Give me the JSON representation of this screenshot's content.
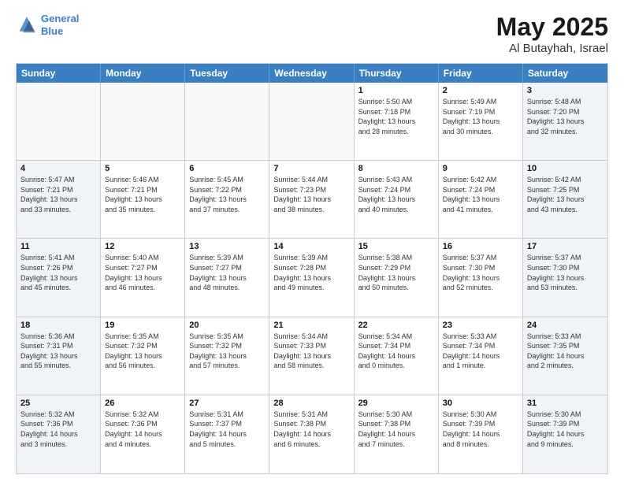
{
  "header": {
    "logo_line1": "General",
    "logo_line2": "Blue",
    "month": "May 2025",
    "location": "Al Butayhah, Israel"
  },
  "weekdays": [
    "Sunday",
    "Monday",
    "Tuesday",
    "Wednesday",
    "Thursday",
    "Friday",
    "Saturday"
  ],
  "rows": [
    [
      {
        "day": "",
        "info": ""
      },
      {
        "day": "",
        "info": ""
      },
      {
        "day": "",
        "info": ""
      },
      {
        "day": "",
        "info": ""
      },
      {
        "day": "1",
        "info": "Sunrise: 5:50 AM\nSunset: 7:18 PM\nDaylight: 13 hours\nand 28 minutes."
      },
      {
        "day": "2",
        "info": "Sunrise: 5:49 AM\nSunset: 7:19 PM\nDaylight: 13 hours\nand 30 minutes."
      },
      {
        "day": "3",
        "info": "Sunrise: 5:48 AM\nSunset: 7:20 PM\nDaylight: 13 hours\nand 32 minutes."
      }
    ],
    [
      {
        "day": "4",
        "info": "Sunrise: 5:47 AM\nSunset: 7:21 PM\nDaylight: 13 hours\nand 33 minutes."
      },
      {
        "day": "5",
        "info": "Sunrise: 5:46 AM\nSunset: 7:21 PM\nDaylight: 13 hours\nand 35 minutes."
      },
      {
        "day": "6",
        "info": "Sunrise: 5:45 AM\nSunset: 7:22 PM\nDaylight: 13 hours\nand 37 minutes."
      },
      {
        "day": "7",
        "info": "Sunrise: 5:44 AM\nSunset: 7:23 PM\nDaylight: 13 hours\nand 38 minutes."
      },
      {
        "day": "8",
        "info": "Sunrise: 5:43 AM\nSunset: 7:24 PM\nDaylight: 13 hours\nand 40 minutes."
      },
      {
        "day": "9",
        "info": "Sunrise: 5:42 AM\nSunset: 7:24 PM\nDaylight: 13 hours\nand 41 minutes."
      },
      {
        "day": "10",
        "info": "Sunrise: 5:42 AM\nSunset: 7:25 PM\nDaylight: 13 hours\nand 43 minutes."
      }
    ],
    [
      {
        "day": "11",
        "info": "Sunrise: 5:41 AM\nSunset: 7:26 PM\nDaylight: 13 hours\nand 45 minutes."
      },
      {
        "day": "12",
        "info": "Sunrise: 5:40 AM\nSunset: 7:27 PM\nDaylight: 13 hours\nand 46 minutes."
      },
      {
        "day": "13",
        "info": "Sunrise: 5:39 AM\nSunset: 7:27 PM\nDaylight: 13 hours\nand 48 minutes."
      },
      {
        "day": "14",
        "info": "Sunrise: 5:39 AM\nSunset: 7:28 PM\nDaylight: 13 hours\nand 49 minutes."
      },
      {
        "day": "15",
        "info": "Sunrise: 5:38 AM\nSunset: 7:29 PM\nDaylight: 13 hours\nand 50 minutes."
      },
      {
        "day": "16",
        "info": "Sunrise: 5:37 AM\nSunset: 7:30 PM\nDaylight: 13 hours\nand 52 minutes."
      },
      {
        "day": "17",
        "info": "Sunrise: 5:37 AM\nSunset: 7:30 PM\nDaylight: 13 hours\nand 53 minutes."
      }
    ],
    [
      {
        "day": "18",
        "info": "Sunrise: 5:36 AM\nSunset: 7:31 PM\nDaylight: 13 hours\nand 55 minutes."
      },
      {
        "day": "19",
        "info": "Sunrise: 5:35 AM\nSunset: 7:32 PM\nDaylight: 13 hours\nand 56 minutes."
      },
      {
        "day": "20",
        "info": "Sunrise: 5:35 AM\nSunset: 7:32 PM\nDaylight: 13 hours\nand 57 minutes."
      },
      {
        "day": "21",
        "info": "Sunrise: 5:34 AM\nSunset: 7:33 PM\nDaylight: 13 hours\nand 58 minutes."
      },
      {
        "day": "22",
        "info": "Sunrise: 5:34 AM\nSunset: 7:34 PM\nDaylight: 14 hours\nand 0 minutes."
      },
      {
        "day": "23",
        "info": "Sunrise: 5:33 AM\nSunset: 7:34 PM\nDaylight: 14 hours\nand 1 minute."
      },
      {
        "day": "24",
        "info": "Sunrise: 5:33 AM\nSunset: 7:35 PM\nDaylight: 14 hours\nand 2 minutes."
      }
    ],
    [
      {
        "day": "25",
        "info": "Sunrise: 5:32 AM\nSunset: 7:36 PM\nDaylight: 14 hours\nand 3 minutes."
      },
      {
        "day": "26",
        "info": "Sunrise: 5:32 AM\nSunset: 7:36 PM\nDaylight: 14 hours\nand 4 minutes."
      },
      {
        "day": "27",
        "info": "Sunrise: 5:31 AM\nSunset: 7:37 PM\nDaylight: 14 hours\nand 5 minutes."
      },
      {
        "day": "28",
        "info": "Sunrise: 5:31 AM\nSunset: 7:38 PM\nDaylight: 14 hours\nand 6 minutes."
      },
      {
        "day": "29",
        "info": "Sunrise: 5:30 AM\nSunset: 7:38 PM\nDaylight: 14 hours\nand 7 minutes."
      },
      {
        "day": "30",
        "info": "Sunrise: 5:30 AM\nSunset: 7:39 PM\nDaylight: 14 hours\nand 8 minutes."
      },
      {
        "day": "31",
        "info": "Sunrise: 5:30 AM\nSunset: 7:39 PM\nDaylight: 14 hours\nand 9 minutes."
      }
    ]
  ]
}
